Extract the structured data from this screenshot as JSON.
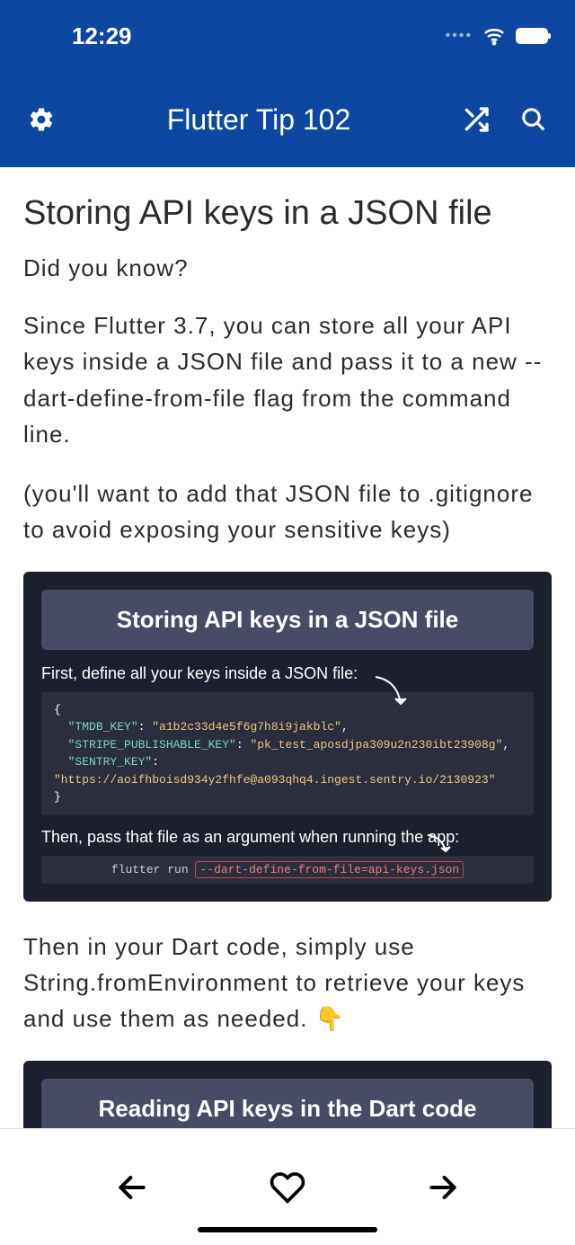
{
  "status": {
    "time": "12:29"
  },
  "appbar": {
    "title": "Flutter Tip 102"
  },
  "article": {
    "title": "Storing API keys in a JSON file",
    "subtitle": "Did you know?",
    "p1": "Since Flutter 3.7, you can store all your API keys inside a JSON file and pass it to a new --dart-define-from-file flag from the command line.",
    "p2": "(you'll want to add that JSON file to .gitignore to avoid exposing your sensitive keys)",
    "card1": {
      "header": "Storing API keys in a JSON file",
      "text1": "First, define all your keys inside a JSON file:",
      "code": {
        "key1": "\"TMDB_KEY\"",
        "val1": "\"a1b2c33d4e5f6g7h8i9jakblc\"",
        "key2": "\"STRIPE_PUBLISHABLE_KEY\"",
        "val2": "\"pk_test_aposdjpa309u2n230ibt23908g\"",
        "key3": "\"SENTRY_KEY\"",
        "val3": "\"https://aoifhboisd934y2fhfe@a093qhq4.ingest.sentry.io/2130923\""
      },
      "text2": "Then, pass that file as an argument when running the app:",
      "cmd": "flutter run",
      "flag": "--dart-define-from-file=api-keys.json"
    },
    "p3": "Then in your Dart code, simply use String.fromEnvironment to retrieve your keys and use them as needed. 👇",
    "card2": {
      "header": "Reading API keys in the Dart code"
    }
  }
}
